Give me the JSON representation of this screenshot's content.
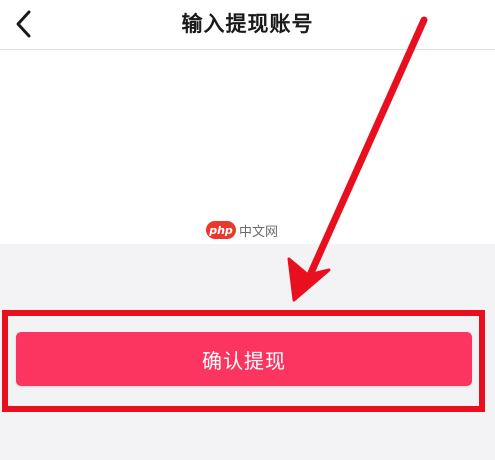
{
  "header": {
    "title": "输入提现账号",
    "back_icon": "chevron-left-icon"
  },
  "watermark": {
    "badge": "php",
    "text": "中文网"
  },
  "actions": {
    "confirm_label": "确认提现"
  },
  "annotation": {
    "color": "#e8101e"
  },
  "colors": {
    "button_bg": "#fb3560",
    "page_gray": "#f3f3f5"
  }
}
